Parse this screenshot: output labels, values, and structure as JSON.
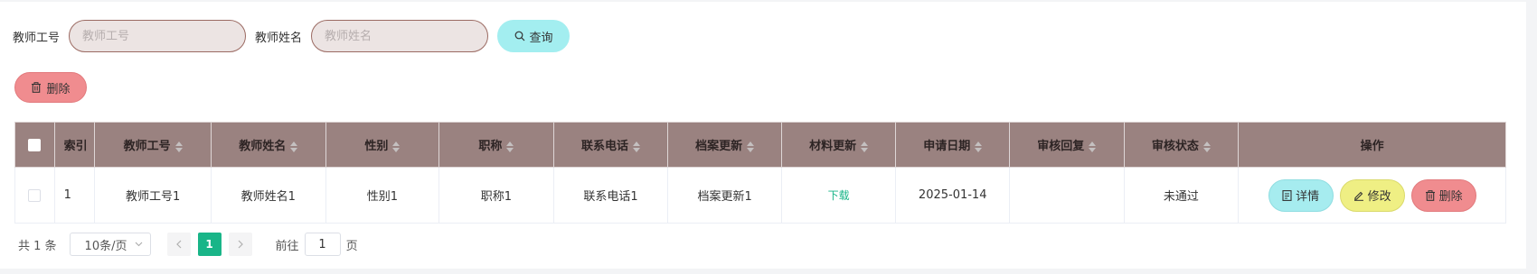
{
  "search": {
    "teacher_id_label": "教师工号",
    "teacher_id_placeholder": "教师工号",
    "teacher_name_label": "教师姓名",
    "teacher_name_placeholder": "教师姓名",
    "query_label": "查询"
  },
  "toolbar": {
    "delete_label": "删除"
  },
  "table": {
    "columns": {
      "index": "索引",
      "teacher_id": "教师工号",
      "teacher_name": "教师姓名",
      "gender": "性别",
      "title": "职称",
      "phone": "联系电话",
      "archive_update": "档案更新",
      "material_update": "材料更新",
      "apply_date": "申请日期",
      "review_reply": "审核回复",
      "review_status": "审核状态",
      "actions": "操作"
    },
    "rows": [
      {
        "index": "1",
        "teacher_id": "教师工号1",
        "teacher_name": "教师姓名1",
        "gender": "性别1",
        "title": "职称1",
        "phone": "联系电话1",
        "archive_update": "档案更新1",
        "material_update": "下载",
        "apply_date": "2025-01-14",
        "review_reply": "",
        "review_status": "未通过",
        "actions": {
          "detail": "详情",
          "edit": "修改",
          "delete": "删除"
        }
      }
    ]
  },
  "pagination": {
    "total": "共 1 条",
    "page_size": "10条/页",
    "current_page": "1",
    "goto_label": "前往",
    "goto_value": "1",
    "page_unit": "页"
  },
  "colors": {
    "header_bg": "#9a8280",
    "accent": "#19b588",
    "query_button": "#a3eef0",
    "delete_button": "#f08c8f",
    "edit_button": "#efef84"
  },
  "icons": {
    "query": "search-icon",
    "delete": "trash-icon",
    "detail": "document-icon",
    "edit": "edit-icon",
    "page_size": "chevron-down-icon",
    "prev": "chevron-left-icon",
    "next": "chevron-right-icon"
  }
}
